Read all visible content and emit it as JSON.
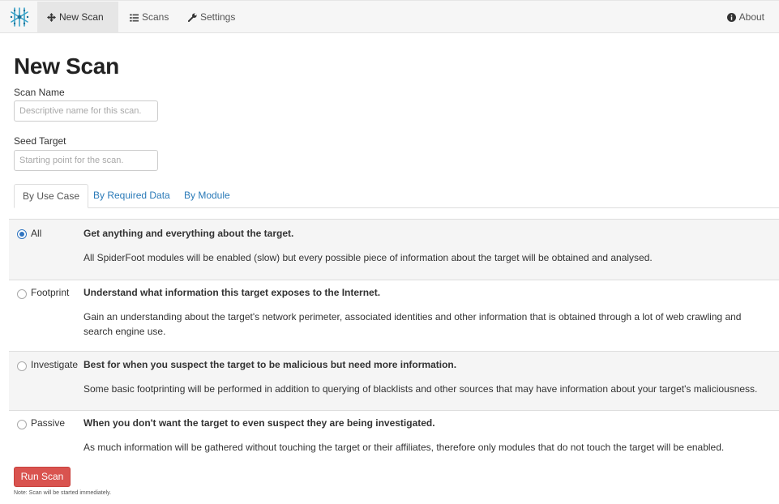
{
  "navbar": {
    "items": [
      {
        "label": "New Scan",
        "icon": "move-icon",
        "active": true
      },
      {
        "label": "Scans",
        "icon": "list-icon",
        "active": false
      },
      {
        "label": "Settings",
        "icon": "wrench-icon",
        "active": false
      }
    ],
    "about": {
      "label": "About",
      "icon": "info-icon"
    }
  },
  "page": {
    "title": "New Scan"
  },
  "form": {
    "scan_name": {
      "label": "Scan Name",
      "value": "",
      "placeholder": "Descriptive name for this scan."
    },
    "seed_target": {
      "label": "Seed Target",
      "value": "",
      "placeholder": "Starting point for the scan."
    }
  },
  "tabs": [
    {
      "label": "By Use Case",
      "active": true
    },
    {
      "label": "By Required Data",
      "active": false
    },
    {
      "label": "By Module",
      "active": false
    }
  ],
  "use_cases": [
    {
      "name": "All",
      "selected": true,
      "heading": "Get anything and everything about the target.",
      "description": "All SpiderFoot modules will be enabled (slow) but every possible piece of information about the target will be obtained and analysed."
    },
    {
      "name": "Footprint",
      "selected": false,
      "heading": "Understand what information this target exposes to the Internet.",
      "description": "Gain an understanding about the target's network perimeter, associated identities and other information that is obtained through a lot of web crawling and search engine use."
    },
    {
      "name": "Investigate",
      "selected": false,
      "heading": "Best for when you suspect the target to be malicious but need more information.",
      "description": "Some basic footprinting will be performed in addition to querying of blacklists and other sources that may have information about your target's maliciousness."
    },
    {
      "name": "Passive",
      "selected": false,
      "heading": "When you don't want the target to even suspect they are being investigated.",
      "description": "As much information will be gathered without touching the target or their affiliates, therefore only modules that do not touch the target will be enabled."
    }
  ],
  "actions": {
    "run_label": "Run Scan",
    "note": "Note: Scan will be started immediately."
  },
  "colors": {
    "accent": "#2a7ab8",
    "danger": "#d9534f",
    "radio_checked": "#2f74c0",
    "navbar": "#f6f6f6"
  }
}
